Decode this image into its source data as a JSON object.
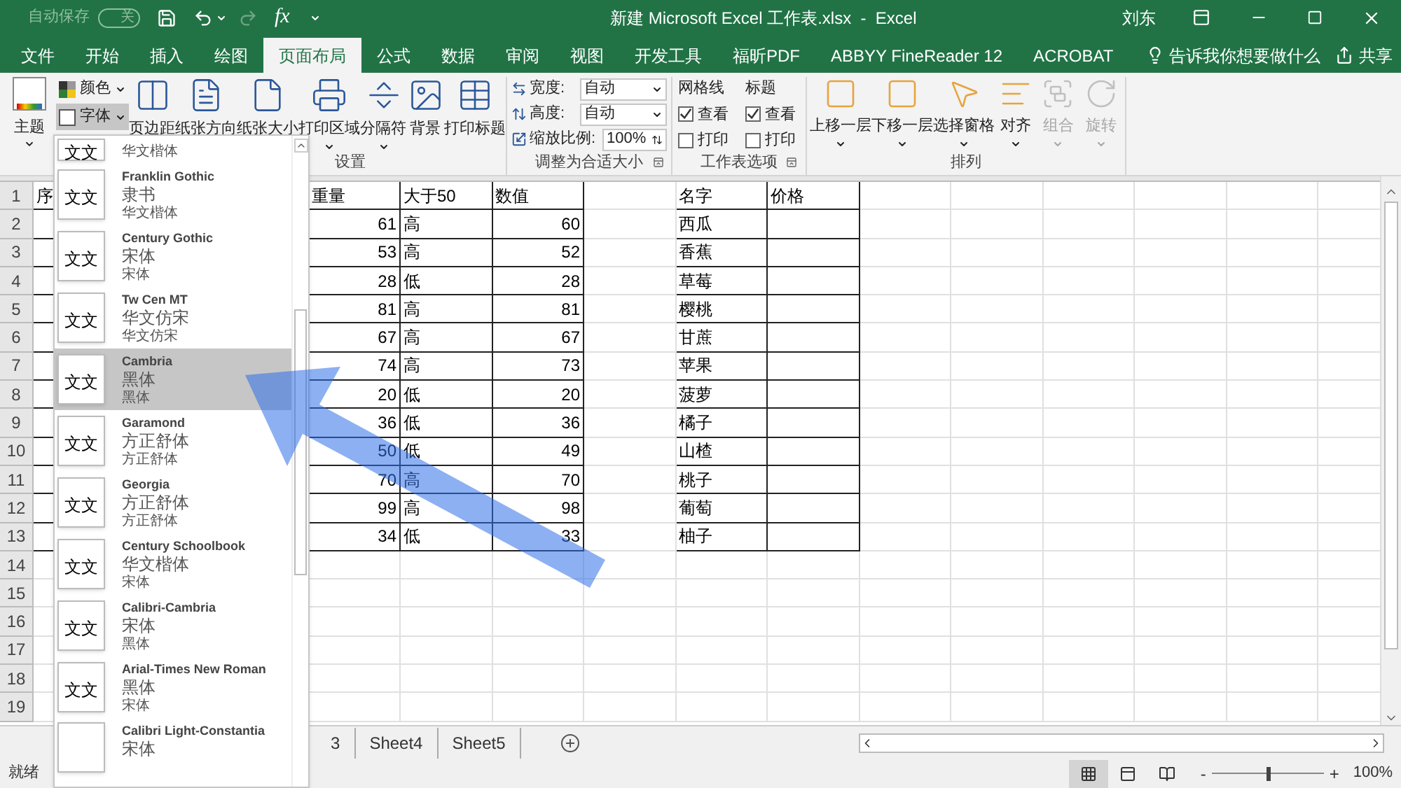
{
  "title_bar": {
    "autosave_label": "自动保存",
    "autosave_state": "关",
    "autosave_on": false,
    "function_button": "fx",
    "title": "新建 Microsoft Excel 工作表.xlsx  -  Excel",
    "user": "刘东"
  },
  "tabs": [
    {
      "label": "文件",
      "selected": false
    },
    {
      "label": "开始",
      "selected": false
    },
    {
      "label": "插入",
      "selected": false
    },
    {
      "label": "绘图",
      "selected": false
    },
    {
      "label": "页面布局",
      "selected": true
    },
    {
      "label": "公式",
      "selected": false
    },
    {
      "label": "数据",
      "selected": false
    },
    {
      "label": "审阅",
      "selected": false
    },
    {
      "label": "视图",
      "selected": false
    },
    {
      "label": "开发工具",
      "selected": false
    },
    {
      "label": "福昕PDF",
      "selected": false
    },
    {
      "label": "ABBYY FineReader 12",
      "selected": false
    },
    {
      "label": "ACROBAT",
      "selected": false
    }
  ],
  "tell_me": "告诉我你想要做什么",
  "share": "共享",
  "ribbon": {
    "themes": "主题",
    "colors": "颜色",
    "fonts": {
      "label": "字体",
      "pressed": true
    },
    "page_setup": {
      "buttons": [
        {
          "label": "页边距"
        },
        {
          "label": "纸张方向"
        },
        {
          "label": "纸张大小"
        },
        {
          "label": "打印区域",
          "dropdown": true
        },
        {
          "label": "分隔符",
          "dropdown": true
        },
        {
          "label": "背景"
        },
        {
          "label": "打印标题"
        }
      ],
      "group_label": "设置"
    },
    "scale": {
      "fields": [
        {
          "kind": "select",
          "label": "宽度:",
          "value": "自动"
        },
        {
          "kind": "select",
          "label": "高度:",
          "value": "自动"
        },
        {
          "kind": "spinner",
          "label": "缩放比例:",
          "value": "100%"
        }
      ],
      "group_label": "调整为合适大小"
    },
    "sheet_options": {
      "columns": [
        {
          "title": "网格线",
          "options": [
            {
              "label": "查看",
              "checked": true
            },
            {
              "label": "打印",
              "checked": false
            }
          ]
        },
        {
          "title": "标题",
          "options": [
            {
              "label": "查看",
              "checked": true
            },
            {
              "label": "打印",
              "checked": false
            }
          ]
        }
      ],
      "group_label": "工作表选项"
    },
    "arrange": {
      "buttons": [
        {
          "label": "上移一层",
          "disabled": false
        },
        {
          "label": "下移一层",
          "disabled": false
        },
        {
          "label": "选择窗格",
          "disabled": false
        },
        {
          "label": "对齐",
          "disabled": false
        },
        {
          "label": "组合",
          "disabled": true
        },
        {
          "label": "旋转",
          "disabled": true
        }
      ],
      "group_label": "排列"
    }
  },
  "font_menu": {
    "items": [
      {
        "sample": "文文",
        "body": "华文楷体",
        "selected": false
      },
      {
        "sample": "文文",
        "name": "Franklin Gothic",
        "heading": "隶书",
        "body": "华文楷体",
        "selected": false
      },
      {
        "sample": "文文",
        "name": "Century Gothic",
        "heading": "宋体",
        "body": "宋体",
        "selected": false
      },
      {
        "sample": "文文",
        "name": "Tw Cen MT",
        "heading": "华文仿宋",
        "body": "华文仿宋",
        "selected": false
      },
      {
        "sample": "文文",
        "name": "Cambria",
        "heading": "黑体",
        "body": "黑体",
        "selected": true
      },
      {
        "sample": "文文",
        "name": "Garamond",
        "heading": "方正舒体",
        "body": "方正舒体",
        "selected": false
      },
      {
        "sample": "文文",
        "name": "Georgia",
        "heading": "方正舒体",
        "body": "方正舒体",
        "selected": false
      },
      {
        "sample": "文文",
        "name": "Century Schoolbook",
        "heading": "华文楷体",
        "body": "宋体",
        "selected": false
      },
      {
        "sample": "文文",
        "name": "Calibri-Cambria",
        "heading": "宋体",
        "body": "黑体",
        "selected": false
      },
      {
        "sample": "文文",
        "name": "Arial-Times New Roman",
        "heading": "黑体",
        "body": "宋体",
        "selected": false
      },
      {
        "name": "Calibri Light-Constantia",
        "heading": "宋体",
        "selected": false
      }
    ]
  },
  "grid": {
    "row_numbers": [
      "1",
      "2",
      "3",
      "4",
      "5",
      "6",
      "7",
      "8",
      "9",
      "10",
      "11",
      "12",
      "13",
      "14",
      "15",
      "16",
      "17",
      "18",
      "19"
    ],
    "header": {
      "A": "序",
      "D": "重量",
      "E": "大于50",
      "F": "数值",
      "H": "名字",
      "I": "价格"
    },
    "rows": [
      {
        "D": "61",
        "E": "高",
        "F": "60",
        "H": "西瓜"
      },
      {
        "D": "53",
        "E": "高",
        "F": "52",
        "H": "香蕉"
      },
      {
        "D": "28",
        "E": "低",
        "F": "28",
        "H": "草莓"
      },
      {
        "D": "81",
        "E": "高",
        "F": "81",
        "H": "樱桃"
      },
      {
        "D": "67",
        "E": "高",
        "F": "67",
        "H": "甘蔗"
      },
      {
        "D": "74",
        "E": "高",
        "F": "73",
        "H": "苹果"
      },
      {
        "D": "20",
        "E": "低",
        "F": "20",
        "H": "菠萝"
      },
      {
        "D": "36",
        "E": "低",
        "F": "36",
        "H": "橘子"
      },
      {
        "D": "50",
        "E": "低",
        "F": "49",
        "H": "山楂"
      },
      {
        "D": "70",
        "E": "高",
        "F": "70",
        "H": "桃子"
      },
      {
        "D": "99",
        "E": "高",
        "F": "98",
        "H": "葡萄"
      },
      {
        "D": "34",
        "E": "低",
        "F": "33",
        "H": "柚子"
      }
    ]
  },
  "sheet_tabs": [
    {
      "label": "3",
      "selected": false
    },
    {
      "label": "Sheet4",
      "selected": false
    },
    {
      "label": "Sheet5",
      "selected": false
    }
  ],
  "status_bar": {
    "status": "就绪",
    "views": [
      {
        "selected": true
      },
      {
        "selected": false
      },
      {
        "selected": false
      }
    ],
    "zoom_out": "-",
    "zoom_in": "+",
    "zoom": {
      "level": 0.5,
      "reading": "100%"
    }
  }
}
